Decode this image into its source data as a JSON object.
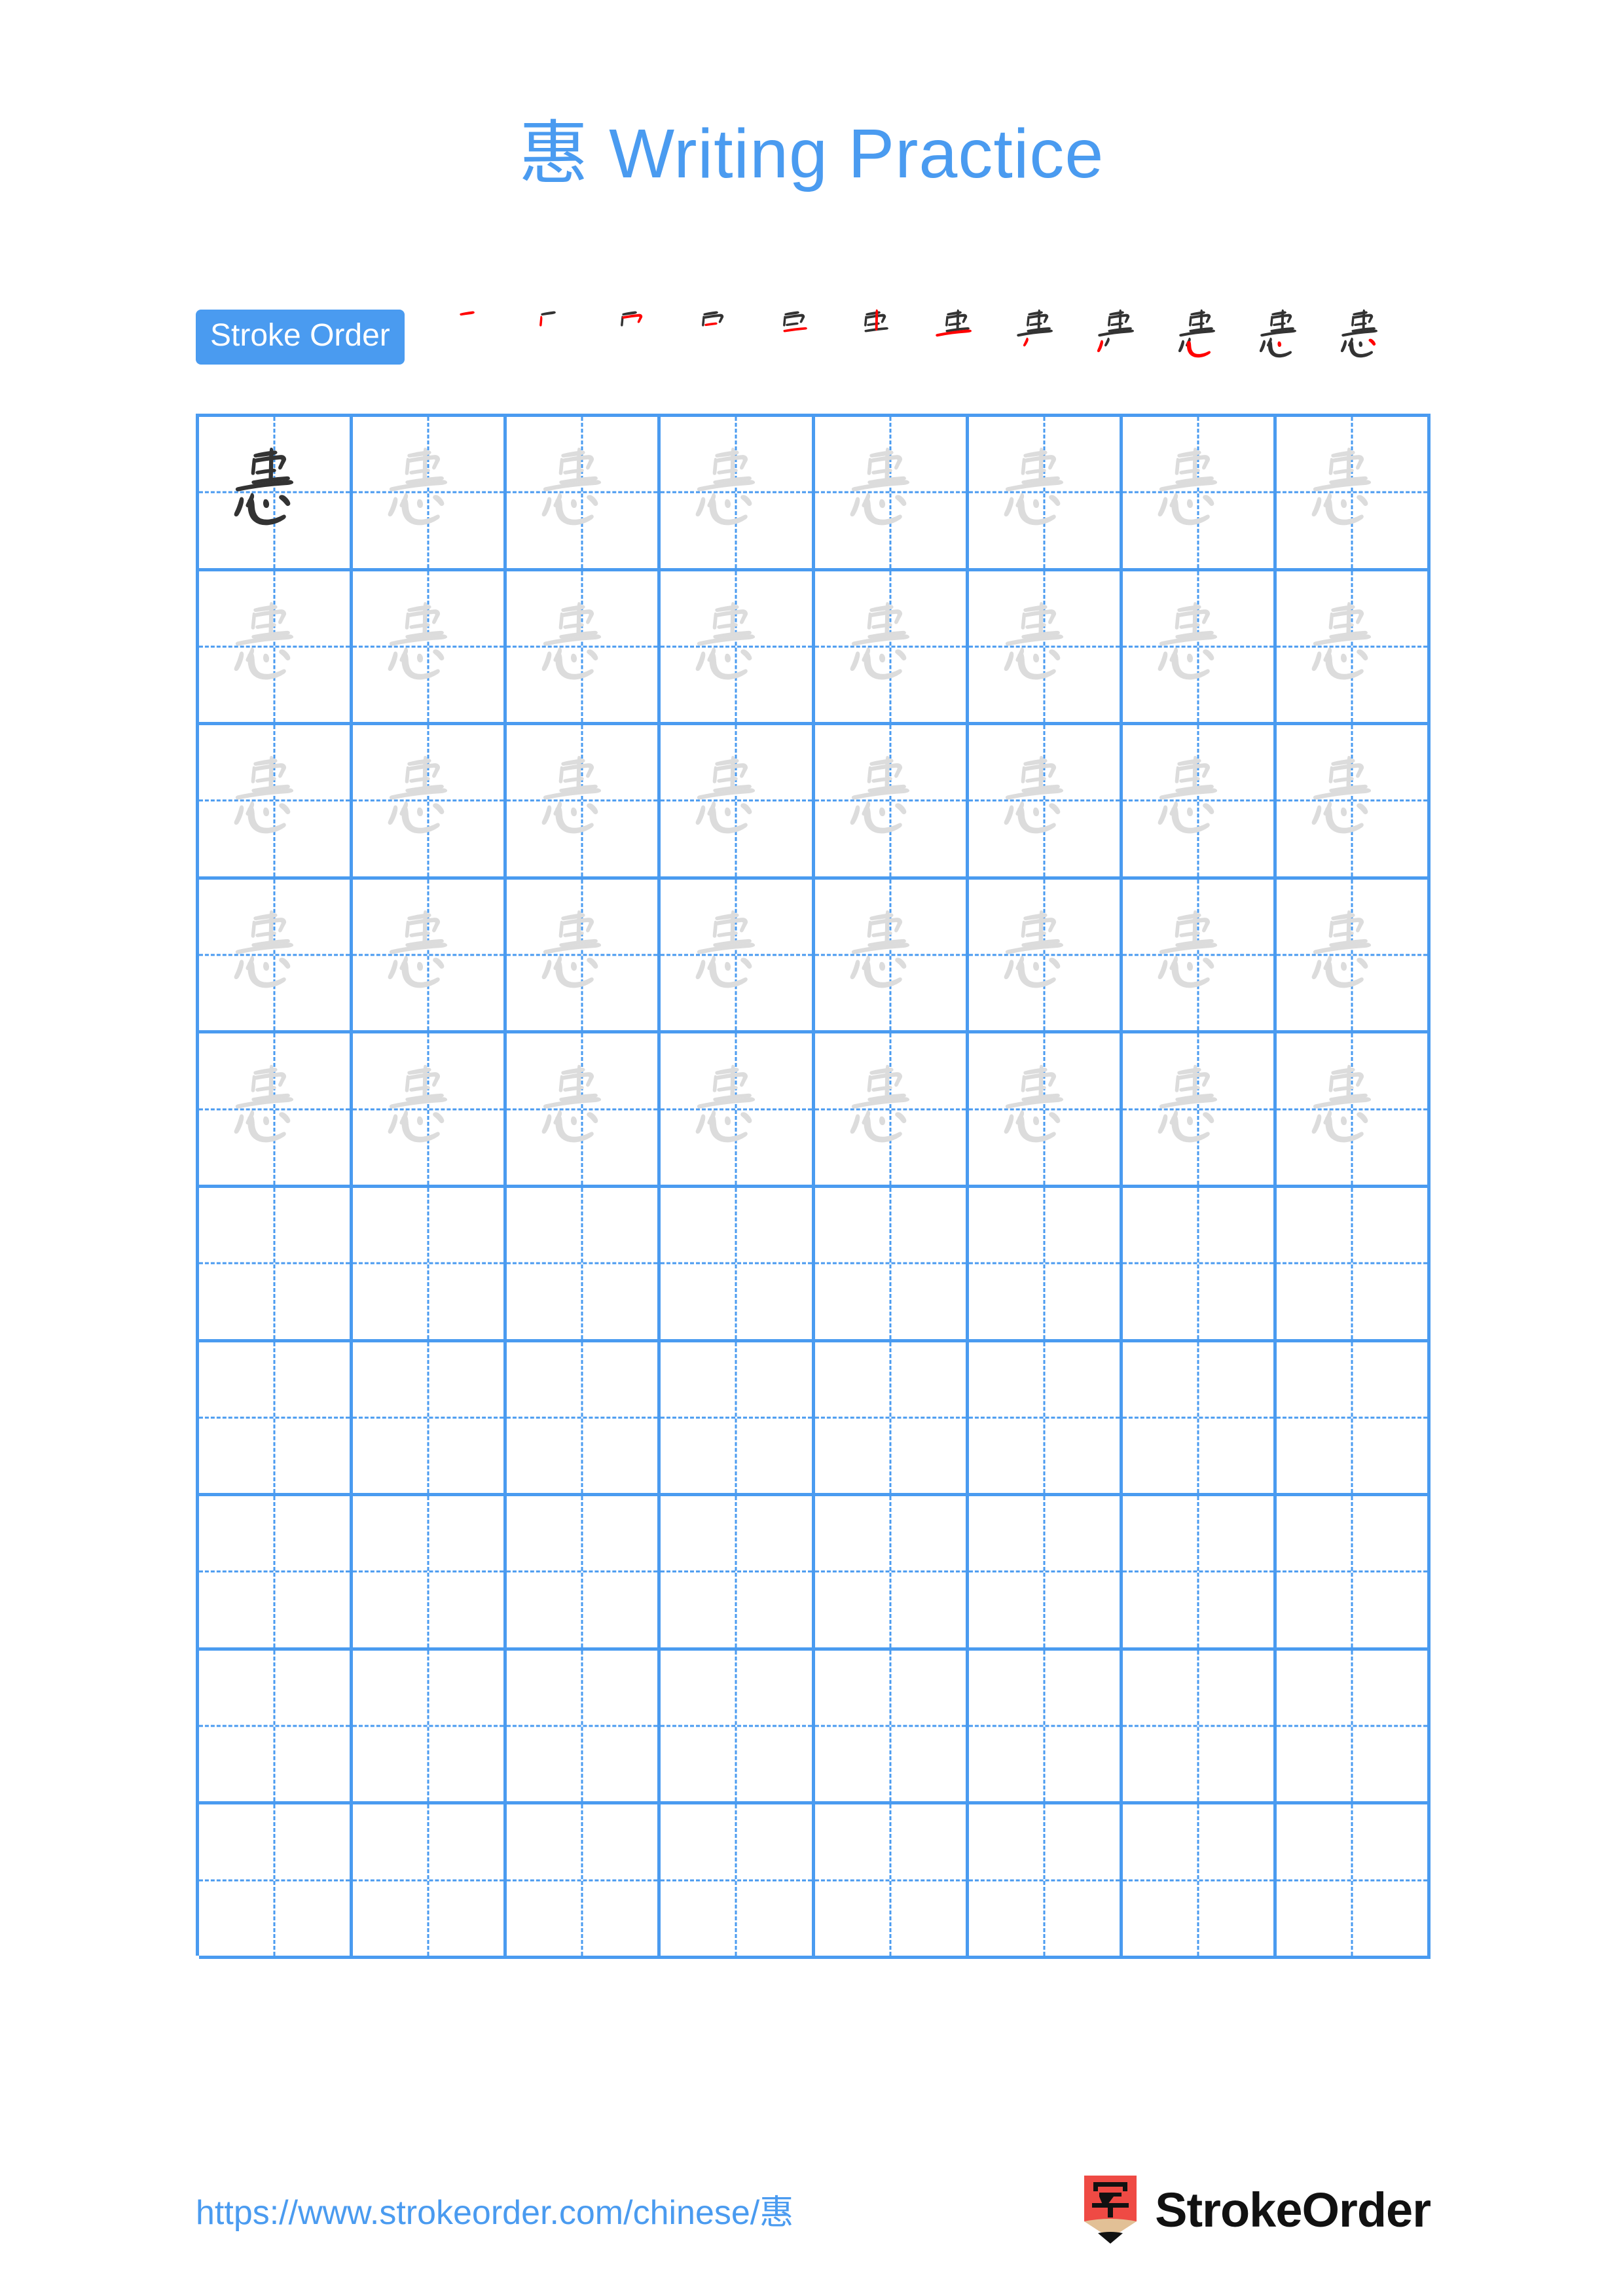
{
  "page": {
    "character": "惠",
    "title_suffix": " Writing Practice",
    "title_full": "惠 Writing Practice",
    "accent_color": "#4a9bf0",
    "grid_line_color": "#4a9bf0",
    "dark_char_color": "#333333",
    "ghost_char_color": "#dcdcdc",
    "new_stroke_color": "#ff0000",
    "background": "#ffffff"
  },
  "stroke_order": {
    "badge_label": "Stroke Order",
    "total_strokes": 12,
    "steps": [
      {
        "index": 1,
        "strokes_shown": 1,
        "new_stroke": "héng (horizontal)"
      },
      {
        "index": 2,
        "strokes_shown": 2,
        "new_stroke": "shù (vertical)"
      },
      {
        "index": 3,
        "strokes_shown": 3,
        "new_stroke": "héngzhé (horizontal-turn)"
      },
      {
        "index": 4,
        "strokes_shown": 4,
        "new_stroke": "héng (horizontal)"
      },
      {
        "index": 5,
        "strokes_shown": 5,
        "new_stroke": "héng (horizontal)"
      },
      {
        "index": 6,
        "strokes_shown": 6,
        "new_stroke": "shù (vertical)"
      },
      {
        "index": 7,
        "strokes_shown": 7,
        "new_stroke": "héng (horizontal)"
      },
      {
        "index": 8,
        "strokes_shown": 8,
        "new_stroke": "diǎn (dot)"
      },
      {
        "index": 9,
        "strokes_shown": 9,
        "new_stroke": "piě (left-falling)"
      },
      {
        "index": 10,
        "strokes_shown": 10,
        "new_stroke": "wògōu (lying hook)"
      },
      {
        "index": 11,
        "strokes_shown": 11,
        "new_stroke": "diǎn (dot)"
      },
      {
        "index": 12,
        "strokes_shown": 12,
        "new_stroke": "diǎn (dot)"
      }
    ]
  },
  "grid": {
    "columns": 8,
    "rows": 10,
    "filled_rows": 5,
    "empty_rows": 5,
    "cells": [
      [
        "dark",
        "ghost",
        "ghost",
        "ghost",
        "ghost",
        "ghost",
        "ghost",
        "ghost"
      ],
      [
        "ghost",
        "ghost",
        "ghost",
        "ghost",
        "ghost",
        "ghost",
        "ghost",
        "ghost"
      ],
      [
        "ghost",
        "ghost",
        "ghost",
        "ghost",
        "ghost",
        "ghost",
        "ghost",
        "ghost"
      ],
      [
        "ghost",
        "ghost",
        "ghost",
        "ghost",
        "ghost",
        "ghost",
        "ghost",
        "ghost"
      ],
      [
        "ghost",
        "ghost",
        "ghost",
        "ghost",
        "ghost",
        "ghost",
        "ghost",
        "ghost"
      ],
      [
        "empty",
        "empty",
        "empty",
        "empty",
        "empty",
        "empty",
        "empty",
        "empty"
      ],
      [
        "empty",
        "empty",
        "empty",
        "empty",
        "empty",
        "empty",
        "empty",
        "empty"
      ],
      [
        "empty",
        "empty",
        "empty",
        "empty",
        "empty",
        "empty",
        "empty",
        "empty"
      ],
      [
        "empty",
        "empty",
        "empty",
        "empty",
        "empty",
        "empty",
        "empty",
        "empty"
      ],
      [
        "empty",
        "empty",
        "empty",
        "empty",
        "empty",
        "empty",
        "empty",
        "empty"
      ]
    ]
  },
  "footer": {
    "url": "https://www.strokeorder.com/chinese/惠",
    "brand_name": "StrokeOrder",
    "logo_character": "字",
    "logo_body_color": "#ef4a44",
    "logo_wood_color": "#e2c096",
    "logo_tip_color": "#111111"
  }
}
